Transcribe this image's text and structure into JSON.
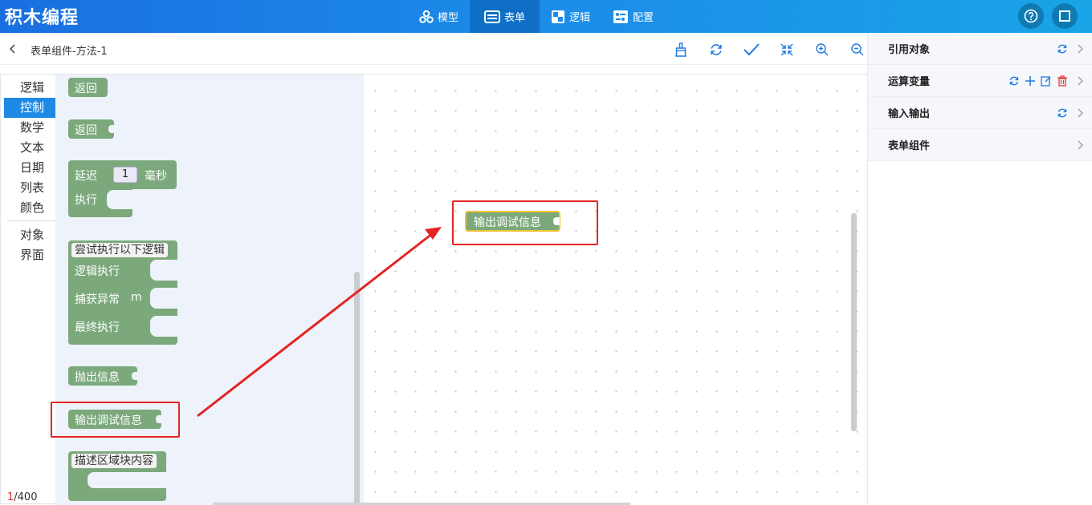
{
  "app": {
    "title": "积木编程"
  },
  "nav": [
    {
      "label": "模型",
      "icon": "model-icon"
    },
    {
      "label": "表单",
      "icon": "form-icon"
    },
    {
      "label": "逻辑",
      "icon": "logic-icon"
    },
    {
      "label": "配置",
      "icon": "config-icon"
    }
  ],
  "header": {
    "breadcrumb": "表单组件-方法-1"
  },
  "toolbar": [
    "brush-icon",
    "refresh-icon",
    "check-icon",
    "collapse-icon",
    "zoom-in-icon",
    "zoom-out-icon"
  ],
  "categories": [
    "逻辑",
    "控制",
    "数学",
    "文本",
    "日期",
    "列表",
    "颜色",
    "对象",
    "界面"
  ],
  "active_category": "控制",
  "blocks": {
    "return1": "返回",
    "return2": "返回",
    "delay": "延迟",
    "delay_value": "1",
    "delay_unit": "毫秒",
    "execute": "执行",
    "try_title": "尝试执行以下逻辑",
    "try_exec": "逻辑执行",
    "try_catch": "捕获异常",
    "try_catch_var": "m",
    "try_finally": "最终执行",
    "throw": "抛出信息",
    "debug": "输出调试信息",
    "describe": "描述区域块内容"
  },
  "canvas_block": "输出调试信息",
  "counter": {
    "current": "1",
    "total": "/400"
  },
  "right_panel": [
    {
      "title": "引用对象"
    },
    {
      "title": "运算变量"
    },
    {
      "title": "输入输出"
    },
    {
      "title": "表单组件"
    }
  ],
  "colors": {
    "accent": "#1f8ae6",
    "block": "#7ca97c",
    "highlight": "#e52424",
    "selected": "#f2c231"
  }
}
